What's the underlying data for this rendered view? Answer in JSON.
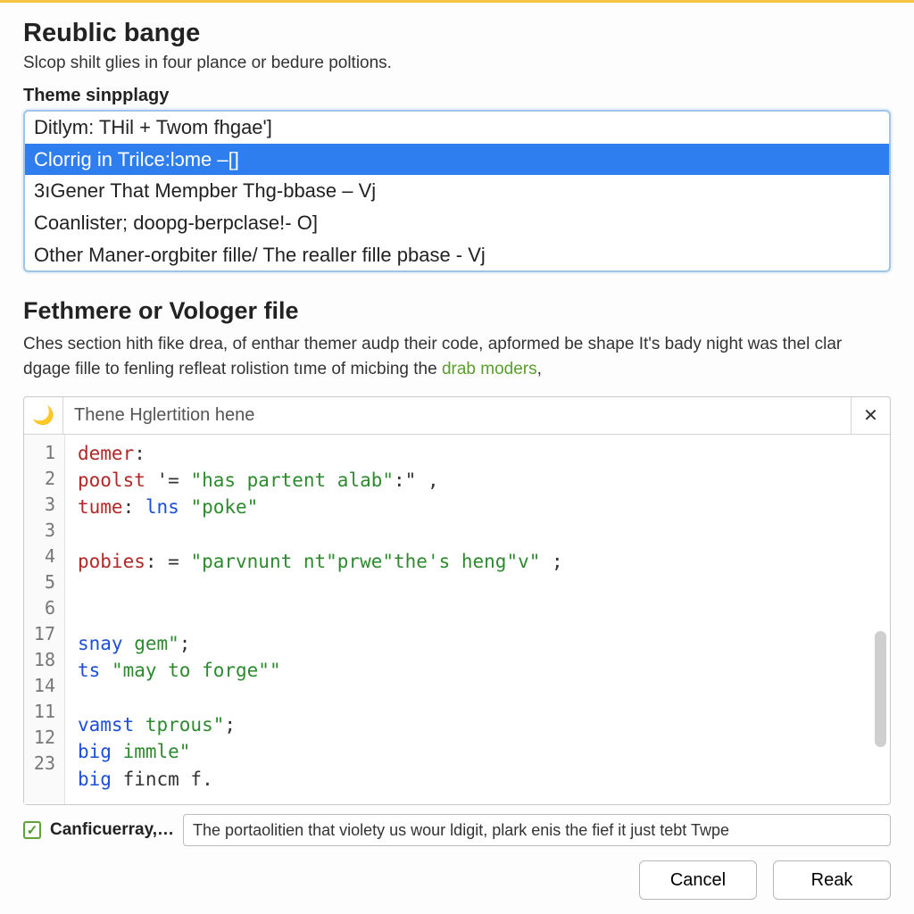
{
  "header": {
    "title": "Reublic bange",
    "subtitle": "Slcop shilt glies in four plance or bedure poltions."
  },
  "themelist": {
    "label": "Theme sinpplagy",
    "items": [
      "Ditlym: THil + Twom fhgae']",
      "Clorrig in Trilce:lɔme –[]",
      "3ıGener That Mempber Thg-bbase – Vj",
      "Coanlister; doopg-berpclase!- O]",
      "Other Maner-orgbiter fille/ The realler fille pbase - Vj"
    ],
    "selected_index": 1
  },
  "section": {
    "title": "Fethmere or Vologer file",
    "desc_prefix": "Ches section hith fike drea, of enthar themer audp their code, apformed be shape It's bady night was thel clar dgage fille to fenling refleat rolistion tıme of micbing the ",
    "desc_link": "drab moders",
    "desc_suffix": ","
  },
  "editor": {
    "tab_icon": "🌙",
    "tab_label": "Thene Hglertition hene",
    "close_glyph": "✕",
    "gutter": [
      "1",
      "2",
      "3",
      "3",
      "4",
      "5",
      "6",
      "17",
      "18",
      "14",
      "11",
      "12",
      "23"
    ],
    "lines": [
      [
        {
          "t": "demer",
          "c": "kw"
        },
        {
          "t": ":",
          "c": "pn"
        }
      ],
      [
        {
          "t": "poolst",
          "c": "kw"
        },
        {
          "t": " '= ",
          "c": "pn"
        },
        {
          "t": "\"has partent alab\"",
          "c": "str"
        },
        {
          "t": ":\" ,",
          "c": "pn"
        }
      ],
      [
        {
          "t": "tume",
          "c": "kw"
        },
        {
          "t": ": ",
          "c": "pn"
        },
        {
          "t": "lns ",
          "c": "id"
        },
        {
          "t": "\"poke\"",
          "c": "str"
        }
      ],
      [],
      [
        {
          "t": "pobies",
          "c": "kw"
        },
        {
          "t": ": = ",
          "c": "pn"
        },
        {
          "t": "\"parvnunt nt\"prwe\"the's heng\"v\"",
          "c": "str"
        },
        {
          "t": " ;",
          "c": "pn"
        }
      ],
      [],
      [],
      [
        {
          "t": "snay ",
          "c": "id"
        },
        {
          "t": "gem\"",
          "c": "str"
        },
        {
          "t": ";",
          "c": "pn"
        }
      ],
      [
        {
          "t": "ts ",
          "c": "id"
        },
        {
          "t": "\"may to forge\"\"",
          "c": "str"
        }
      ],
      [],
      [
        {
          "t": "vamst ",
          "c": "id"
        },
        {
          "t": "tprous\"",
          "c": "str"
        },
        {
          "t": ";",
          "c": "pn"
        }
      ],
      [
        {
          "t": "big ",
          "c": "id"
        },
        {
          "t": "immle\"",
          "c": "str"
        }
      ],
      [
        {
          "t": "big ",
          "c": "id"
        },
        {
          "t": "fincm f.",
          "c": "pn"
        }
      ]
    ]
  },
  "footer": {
    "checkbox_checked": true,
    "checkbox_label": "Canficuerray,…",
    "input_value": "The portaolitien that violety us wour ldigit, plark enis the fief it just tebt Twpe"
  },
  "buttons": {
    "cancel": "Cancel",
    "ok": "Reak"
  }
}
